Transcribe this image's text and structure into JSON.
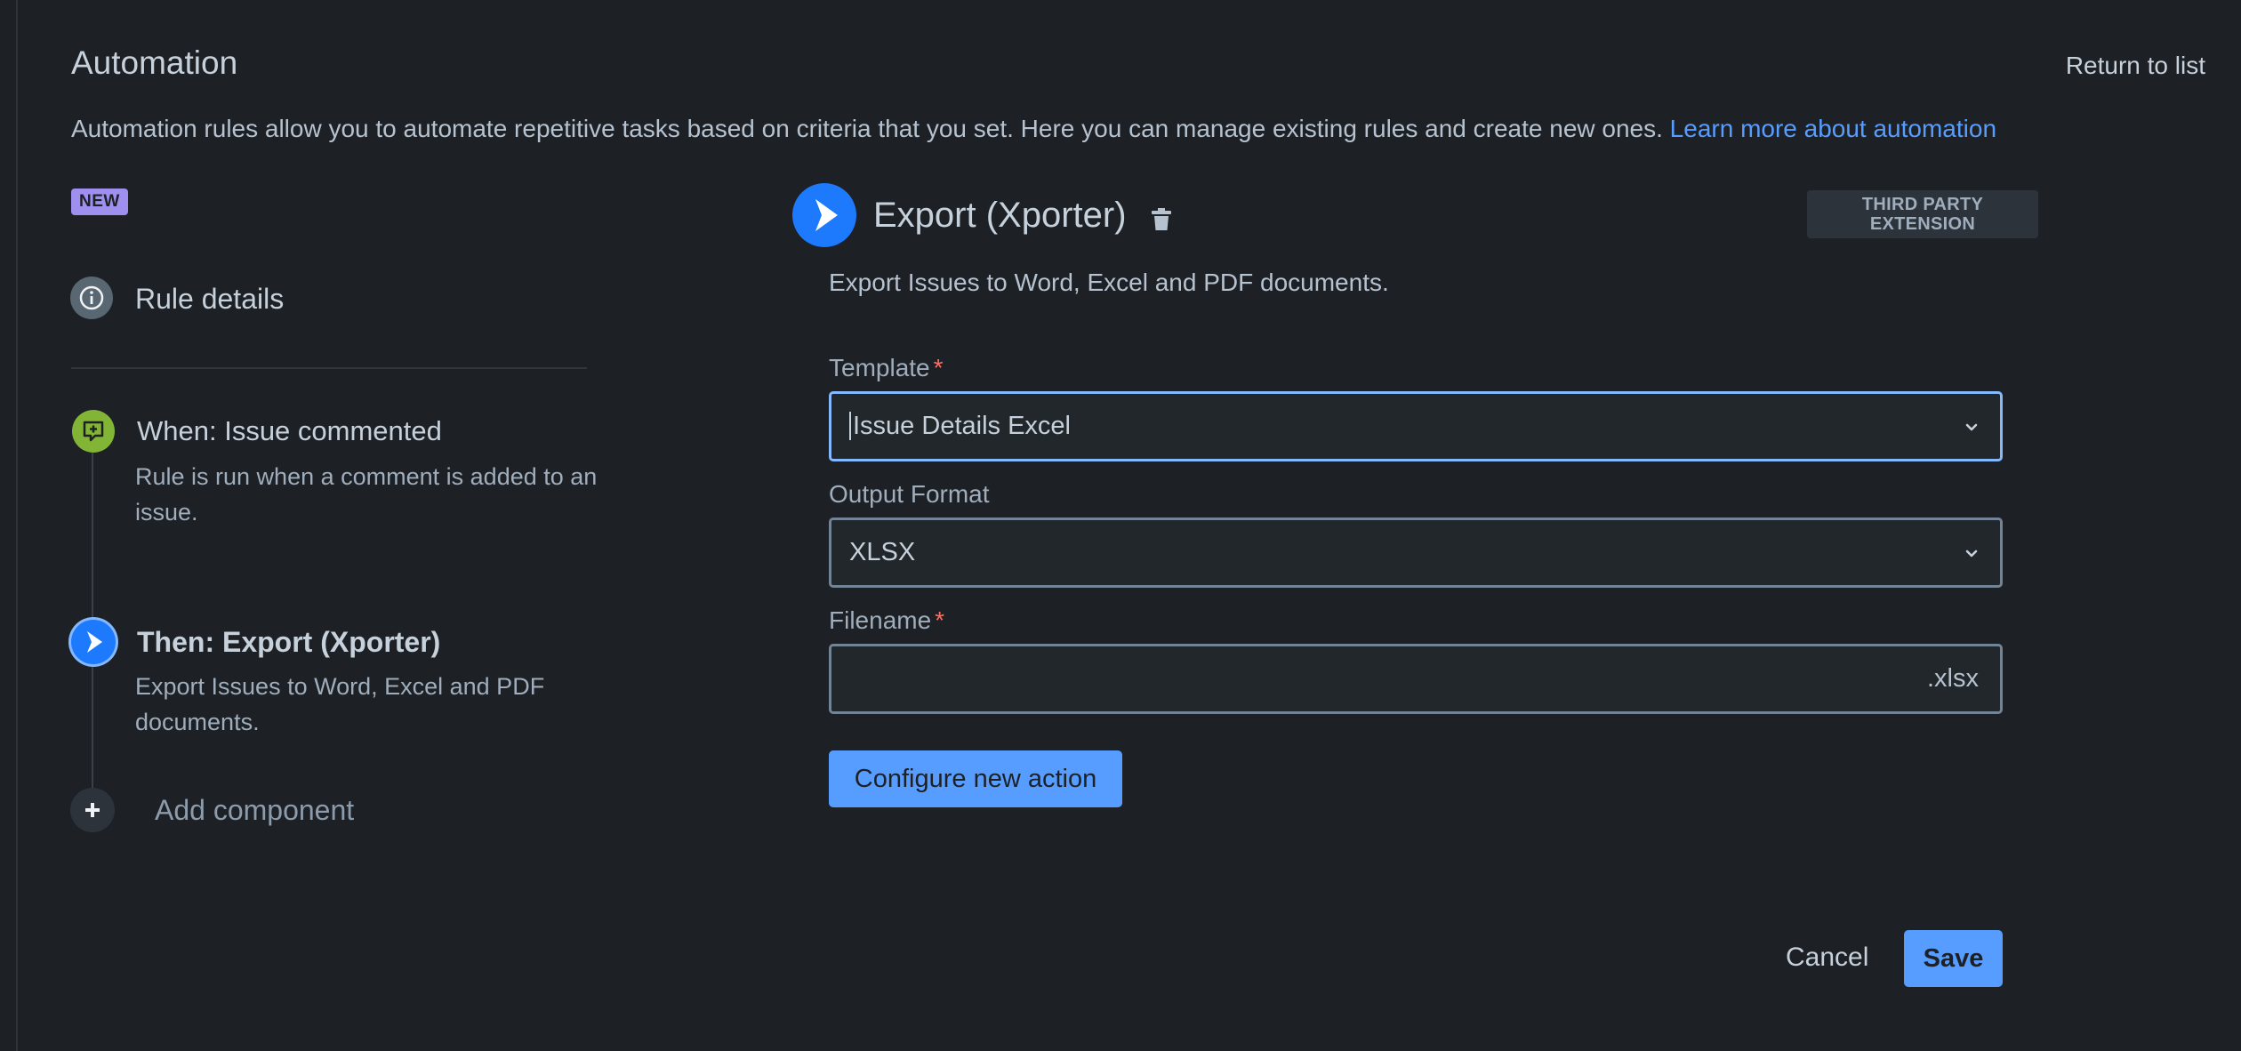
{
  "header": {
    "title": "Automation",
    "return_label": "Return to list",
    "intro": "Automation rules allow you to automate repetitive tasks based on criteria that you set. Here you can manage existing rules and create new ones.",
    "learn_more": "Learn more about automation"
  },
  "sidebar": {
    "badge": "NEW",
    "rule_details": "Rule details",
    "trigger": {
      "title": "When: Issue commented",
      "description": "Rule is run when a comment is added to an issue."
    },
    "action": {
      "title": "Then: Export (Xporter)",
      "description": "Export Issues to Word, Excel and PDF documents."
    },
    "add_component": "Add component"
  },
  "panel": {
    "title": "Export (Xporter)",
    "badge": "THIRD PARTY EXTENSION",
    "description": "Export Issues to Word, Excel and PDF documents.",
    "template": {
      "label": "Template",
      "required": "*",
      "value": "Issue Details Excel"
    },
    "output_format": {
      "label": "Output Format",
      "value": "XLSX"
    },
    "filename": {
      "label": "Filename",
      "required": "*",
      "value": "",
      "suffix": ".xlsx"
    },
    "configure_label": "Configure new action"
  },
  "footer": {
    "cancel_label": "Cancel",
    "save_label": "Save"
  },
  "colors": {
    "background": "#1d2125",
    "accent": "#579dff",
    "trigger_green": "#82b536",
    "action_blue": "#1d7afc",
    "badge_purple": "#9f8fef",
    "required_red": "#f87168"
  }
}
